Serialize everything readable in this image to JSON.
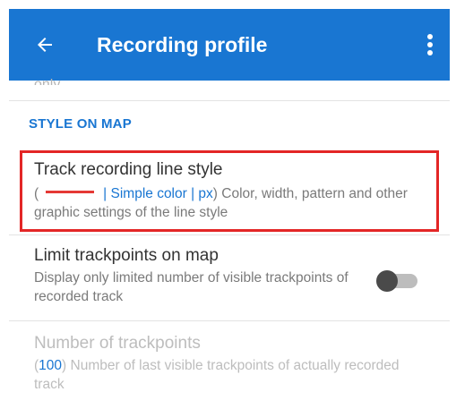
{
  "app_bar": {
    "title": "Recording profile",
    "back_icon": "arrow-back-icon",
    "overflow_icon": "more-vert-icon",
    "background": "#1976d2"
  },
  "previous_item_fragment": "only",
  "section": {
    "header": "STYLE ON MAP"
  },
  "settings": [
    {
      "title": "Track recording line style",
      "desc_open": "(",
      "line_color": "#e53935",
      "desc_value": "| Simple color | px",
      "desc_close": ") Color, width, pattern and other graphic settings of the line style",
      "highlighted": true,
      "highlight_color": "#e32626"
    },
    {
      "title": "Limit trackpoints on map",
      "description": "Display only limited number of visible trackpoints of recorded track",
      "toggle_on": false
    },
    {
      "title": "Number of trackpoints",
      "desc_open": "(",
      "desc_value": "100",
      "desc_close": ") Number of last visible trackpoints of actually recorded track",
      "enabled": false
    }
  ],
  "accent_color": "#1976d2"
}
